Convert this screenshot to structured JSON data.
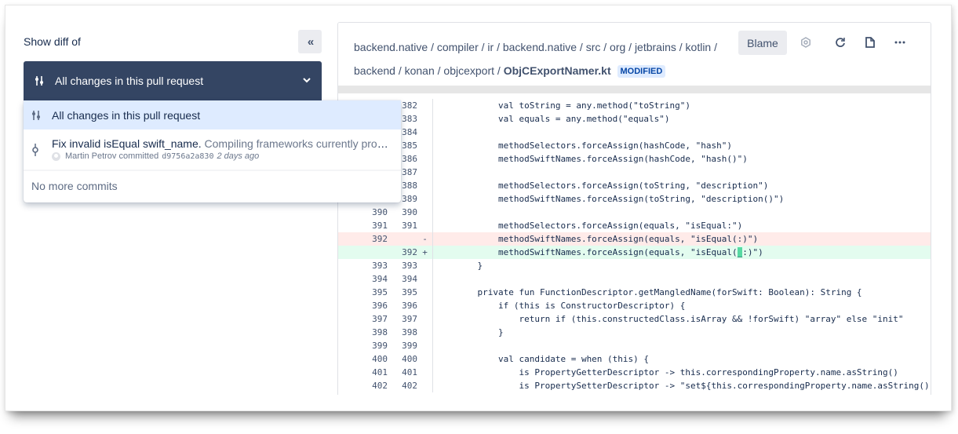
{
  "sidebar": {
    "title": "Show diff of",
    "collapse_icon": "double-chevron-left-icon",
    "collapse_glyph": "«",
    "selector": {
      "label": "All changes in this pull request",
      "icon": "diff-icon"
    },
    "dropdown": {
      "all_changes": "All changes in this pull request",
      "commit": {
        "title": "Fix invalid isEqual swift_name.",
        "description": "Compiling frameworks currently prod...",
        "author": "Martin Petrov",
        "action": "committed",
        "hash": "d9756a2a830",
        "time": "2 days ago"
      },
      "no_more": "No more commits"
    }
  },
  "file": {
    "path": "backend.native / compiler / ir / backend.native / src / org / jetbrains / kotlin / backend / konan / objcexport /",
    "filename": "ObjCExportNamer.kt",
    "status": "MODIFIED",
    "blame_label": "Blame",
    "icons": [
      "settings-icon",
      "refresh-icon",
      "file-icon",
      "more-icon"
    ]
  },
  "diff": [
    {
      "old": "",
      "new": "382",
      "mark": "",
      "type": "ctx",
      "code": "        val toString = any.method(\"toString\")"
    },
    {
      "old": "",
      "new": "383",
      "mark": "",
      "type": "ctx",
      "code": "        val equals = any.method(\"equals\")"
    },
    {
      "old": "",
      "new": "384",
      "mark": "",
      "type": "ctx",
      "code": ""
    },
    {
      "old": "",
      "new": "385",
      "mark": "",
      "type": "ctx",
      "code": "        methodSelectors.forceAssign(hashCode, \"hash\")"
    },
    {
      "old": "",
      "new": "386",
      "mark": "",
      "type": "ctx",
      "code": "        methodSwiftNames.forceAssign(hashCode, \"hash()\")"
    },
    {
      "old": "",
      "new": "387",
      "mark": "",
      "type": "ctx",
      "code": ""
    },
    {
      "old": "",
      "new": "388",
      "mark": "",
      "type": "ctx",
      "code": "        methodSelectors.forceAssign(toString, \"description\")"
    },
    {
      "old": "",
      "new": "389",
      "mark": "",
      "type": "ctx",
      "code": "        methodSwiftNames.forceAssign(toString, \"description()\")"
    },
    {
      "old": "390",
      "new": "390",
      "mark": "",
      "type": "ctx",
      "code": ""
    },
    {
      "old": "391",
      "new": "391",
      "mark": "",
      "type": "ctx",
      "code": "        methodSelectors.forceAssign(equals, \"isEqual:\")"
    },
    {
      "old": "392",
      "new": "",
      "mark": "-",
      "type": "del",
      "code": "        methodSwiftNames.forceAssign(equals, \"isEqual(:)\")"
    },
    {
      "old": "",
      "new": "392",
      "mark": "+",
      "type": "add",
      "code": "        methodSwiftNames.forceAssign(equals, \"isEqual(_:)\")"
    },
    {
      "old": "393",
      "new": "393",
      "mark": "",
      "type": "ctx",
      "code": "    }"
    },
    {
      "old": "394",
      "new": "394",
      "mark": "",
      "type": "ctx",
      "code": ""
    },
    {
      "old": "395",
      "new": "395",
      "mark": "",
      "type": "ctx",
      "code": "    private fun FunctionDescriptor.getMangledName(forSwift: Boolean): String {"
    },
    {
      "old": "396",
      "new": "396",
      "mark": "",
      "type": "ctx",
      "code": "        if (this is ConstructorDescriptor) {"
    },
    {
      "old": "397",
      "new": "397",
      "mark": "",
      "type": "ctx",
      "code": "            return if (this.constructedClass.isArray && !forSwift) \"array\" else \"init\""
    },
    {
      "old": "398",
      "new": "398",
      "mark": "",
      "type": "ctx",
      "code": "        }"
    },
    {
      "old": "399",
      "new": "399",
      "mark": "",
      "type": "ctx",
      "code": ""
    },
    {
      "old": "400",
      "new": "400",
      "mark": "",
      "type": "ctx",
      "code": "        val candidate = when (this) {"
    },
    {
      "old": "401",
      "new": "401",
      "mark": "",
      "type": "ctx",
      "code": "            is PropertyGetterDescriptor -> this.correspondingProperty.name.asString()"
    },
    {
      "old": "402",
      "new": "402",
      "mark": "",
      "type": "ctx",
      "code": "            is PropertySetterDescriptor -> \"set${this.correspondingProperty.name.asString().capi"
    }
  ]
}
